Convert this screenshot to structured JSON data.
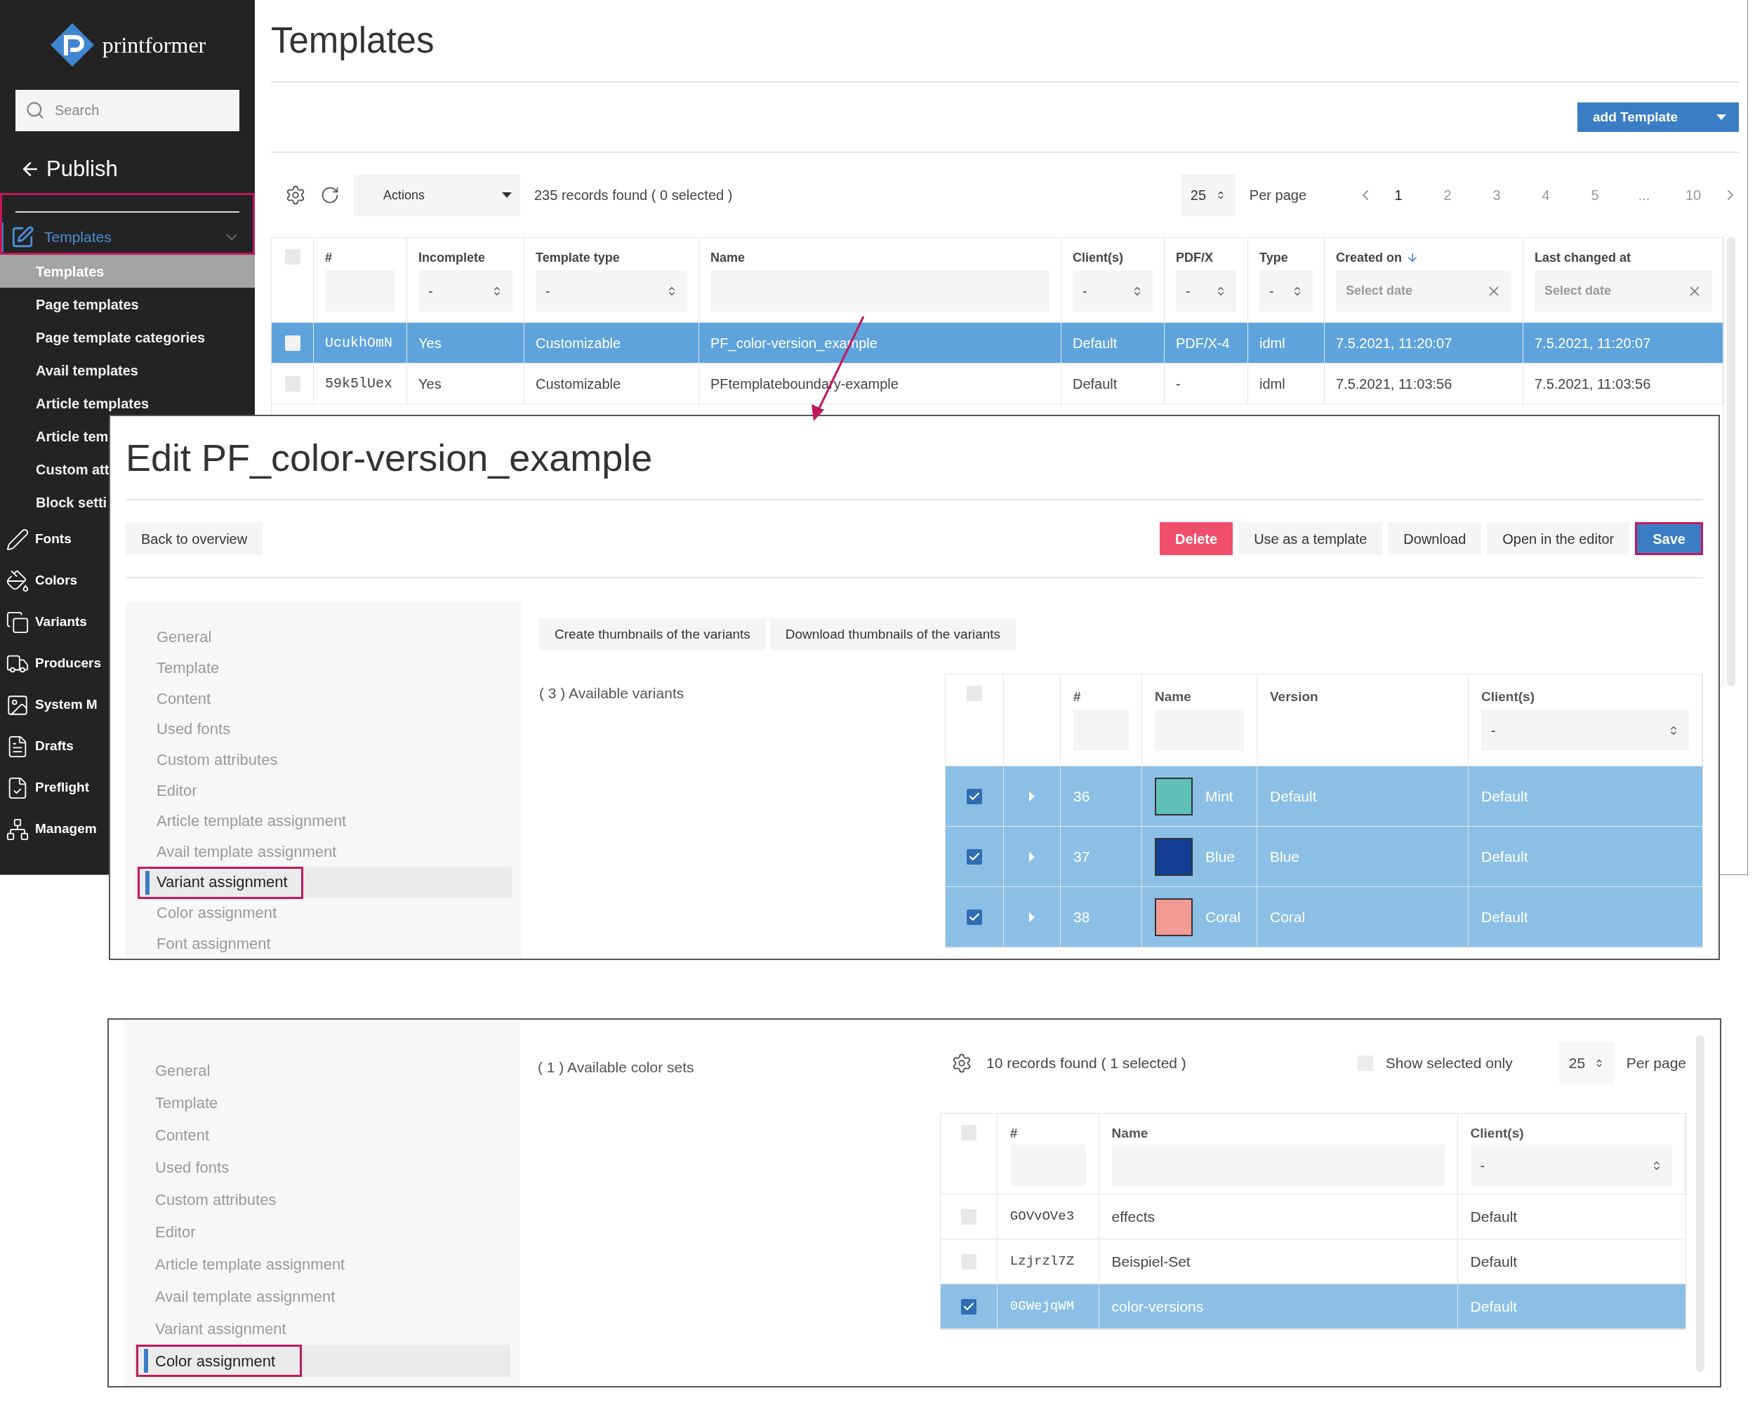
{
  "sidebar": {
    "logo_text": "printformer",
    "search": {
      "placeholder": "Search"
    },
    "back_link": "Publish",
    "group": {
      "label": "Templates",
      "expanded": true,
      "highlighted": true,
      "children": [
        {
          "label": "Templates",
          "selected": true
        },
        {
          "label": "Page templates",
          "selected": false
        },
        {
          "label": "Page template categories",
          "selected": false
        },
        {
          "label": "Avail templates",
          "selected": false
        },
        {
          "label": "Article templates",
          "selected": false
        },
        {
          "label": "Article tem",
          "selected": false
        },
        {
          "label": "Custom att",
          "selected": false
        },
        {
          "label": "Block setti",
          "selected": false
        }
      ]
    },
    "items": [
      {
        "label": "Fonts"
      },
      {
        "label": "Colors"
      },
      {
        "label": "Variants"
      },
      {
        "label": "Producers"
      },
      {
        "label": "System M"
      },
      {
        "label": "Drafts"
      },
      {
        "label": "Preflight"
      },
      {
        "label": "Managem"
      }
    ]
  },
  "page": {
    "title": "Templates",
    "add_button": "add Template",
    "toolbar": {
      "actions": "Actions",
      "records": "235 records found ( 0 selected )",
      "per_page_value": "25",
      "per_page_label": "Per page",
      "pages": [
        {
          "label": "1",
          "selected": true
        },
        {
          "label": "2",
          "selected": false
        },
        {
          "label": "3",
          "selected": false
        },
        {
          "label": "4",
          "selected": false
        },
        {
          "label": "5",
          "selected": false
        },
        {
          "label": "...",
          "selected": false
        },
        {
          "label": "10",
          "selected": false
        }
      ]
    }
  },
  "table": {
    "select_all": {
      "checked": false
    },
    "columns": [
      {
        "label": "#",
        "kind": "text",
        "sorted": false
      },
      {
        "label": "Incomplete",
        "kind": "select",
        "filter_value": "-",
        "sorted": false
      },
      {
        "label": "Template type",
        "kind": "select",
        "filter_value": "-",
        "sorted": false
      },
      {
        "label": "Name",
        "kind": "text",
        "sorted": false
      },
      {
        "label": "Client(s)",
        "kind": "select",
        "filter_value": "-",
        "sorted": false
      },
      {
        "label": "PDF/X",
        "kind": "select",
        "filter_value": "-",
        "sorted": false
      },
      {
        "label": "Type",
        "kind": "select",
        "filter_value": "-",
        "sorted": false
      },
      {
        "label": "Created on",
        "kind": "date",
        "placeholder": "Select date",
        "sorted": true
      },
      {
        "label": "Last changed at",
        "kind": "date",
        "placeholder": "Select date",
        "sorted": false
      }
    ],
    "rows": [
      {
        "selected": true,
        "checked": false,
        "cells": [
          "UcukhOmN",
          "Yes",
          "Customizable",
          "PF_color-version_example",
          "Default",
          "PDF/X-4",
          "idml",
          "7.5.2021, 11:20:07",
          "7.5.2021, 11:20:07"
        ]
      },
      {
        "selected": false,
        "checked": false,
        "cells": [
          "59k5lUex",
          "Yes",
          "Customizable",
          "PFtemplateboundary-example",
          "Default",
          "-",
          "idml",
          "7.5.2021, 11:03:56",
          "7.5.2021, 11:03:56"
        ]
      }
    ]
  },
  "edit_panel": {
    "title": "Edit PF_color-version_example",
    "back_button": "Back to overview",
    "actions": [
      {
        "label": "Delete",
        "kind": "danger",
        "highlighted": false
      },
      {
        "label": "Use as a template",
        "kind": "default",
        "highlighted": false
      },
      {
        "label": "Download",
        "kind": "default",
        "highlighted": false
      },
      {
        "label": "Open in the editor",
        "kind": "default",
        "highlighted": false
      },
      {
        "label": "Save",
        "kind": "primary",
        "highlighted": true
      }
    ],
    "nav": [
      {
        "label": "General",
        "selected": false
      },
      {
        "label": "Template",
        "selected": false
      },
      {
        "label": "Content",
        "selected": false
      },
      {
        "label": "Used fonts",
        "selected": false
      },
      {
        "label": "Custom attributes",
        "selected": false
      },
      {
        "label": "Editor",
        "selected": false
      },
      {
        "label": "Article template assignment",
        "selected": false
      },
      {
        "label": "Avail template assignment",
        "selected": false
      },
      {
        "label": "Variant assignment",
        "selected": true
      },
      {
        "label": "Color assignment",
        "selected": false
      },
      {
        "label": "Font assignment",
        "selected": false
      }
    ],
    "variant_buttons": [
      "Create thumbnails of the variants",
      "Download thumbnails of the variants"
    ],
    "variants_count": "( 3 ) Available variants",
    "variant_table": {
      "select_all": {
        "checked": false
      },
      "columns": [
        {
          "label": "#",
          "kind": "text"
        },
        {
          "label": "Name",
          "kind": "text"
        },
        {
          "label": "Version",
          "kind": "none"
        },
        {
          "label": "Client(s)",
          "kind": "select",
          "filter_value": "-"
        }
      ],
      "rows": [
        {
          "checked": true,
          "selected": true,
          "expanded": false,
          "id": "36",
          "name": "Mint",
          "color": "#5ec0b8",
          "version": "Default",
          "client": "Default"
        },
        {
          "checked": true,
          "selected": true,
          "expanded": false,
          "id": "37",
          "name": "Blue",
          "color": "#123f94",
          "version": "Blue",
          "client": "Default"
        },
        {
          "checked": true,
          "selected": true,
          "expanded": false,
          "id": "38",
          "name": "Coral",
          "color": "#f29a94",
          "version": "Coral",
          "client": "Default"
        }
      ]
    }
  },
  "color_panel": {
    "nav": [
      {
        "label": "General",
        "selected": false
      },
      {
        "label": "Template",
        "selected": false
      },
      {
        "label": "Content",
        "selected": false
      },
      {
        "label": "Used fonts",
        "selected": false
      },
      {
        "label": "Custom attributes",
        "selected": false
      },
      {
        "label": "Editor",
        "selected": false
      },
      {
        "label": "Article template assignment",
        "selected": false
      },
      {
        "label": "Avail template assignment",
        "selected": false
      },
      {
        "label": "Variant assignment",
        "selected": false
      },
      {
        "label": "Color assignment",
        "selected": true
      }
    ],
    "sets_count": "( 1 ) Available color sets",
    "toolbar": {
      "records": "10 records found ( 1 selected )",
      "show_selected": {
        "label": "Show selected only",
        "checked": false
      },
      "per_page_value": "25",
      "per_page_label": "Per page"
    },
    "table": {
      "select_all": {
        "checked": false
      },
      "columns": [
        {
          "label": "#",
          "kind": "text"
        },
        {
          "label": "Name",
          "kind": "text"
        },
        {
          "label": "Client(s)",
          "kind": "select",
          "filter_value": "-"
        }
      ],
      "rows": [
        {
          "checked": false,
          "selected": false,
          "id": "GOVvOVe3",
          "name": "effects",
          "client": "Default"
        },
        {
          "checked": false,
          "selected": false,
          "id": "Lzjrzl7Z",
          "name": "Beispiel-Set",
          "client": "Default"
        },
        {
          "checked": true,
          "selected": true,
          "id": "0GWejqWM",
          "name": "color-versions",
          "client": "Default"
        }
      ]
    }
  }
}
